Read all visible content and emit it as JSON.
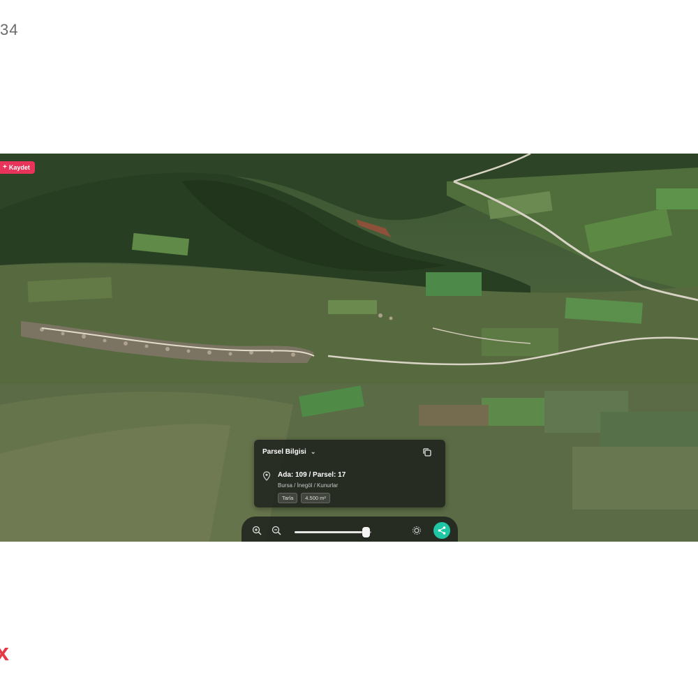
{
  "page": {
    "counter_text": "34",
    "corner_mark": "x"
  },
  "map": {
    "view": "satellite-3d",
    "badge": {
      "label": "Kaydet",
      "icon": "plus-icon",
      "color": "#e8335a"
    },
    "parcel_outline_color": "#e8433a",
    "info_card": {
      "header": "Parsel Bilgisi",
      "header_icon": "chevron-down-icon",
      "action_icon": "copy-icon",
      "location_icon": "map-pin-icon",
      "title": "Ada: 109 / Parsel: 17",
      "location": "Bursa / İnegöl / Kunurlar",
      "chips": [
        "Tarla",
        "4.500 m²"
      ]
    },
    "toolbar": {
      "zoom_in_icon": "zoom-in-icon",
      "zoom_out_icon": "zoom-out-icon",
      "slider_level": 0.93,
      "settings_icon": "gear-icon",
      "share_icon": "share-icon",
      "share_color": "#1fc6a4"
    }
  }
}
